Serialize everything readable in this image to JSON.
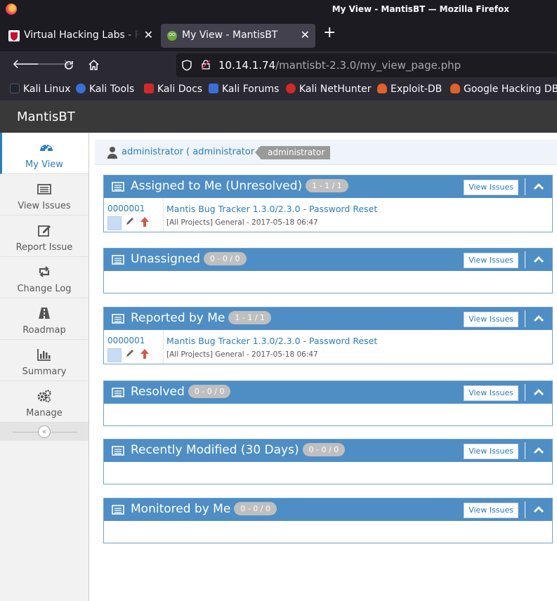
{
  "browser": {
    "window_title": "My View - MantisBT — Mozilla Firefox",
    "tabs": [
      {
        "label": "Virtual Hacking Labs - Re",
        "close": "✕"
      },
      {
        "label": "My View - MantisBT",
        "close": "✕"
      }
    ],
    "new_tab": "+",
    "url_host": "10.14.1.74",
    "url_path": "/mantisbt-2.3.0/my_view_page.php",
    "bookmarks": [
      "Kali Linux",
      "Kali Tools",
      "Kali Docs",
      "Kali Forums",
      "Kali NetHunter",
      "Exploit-DB",
      "Google Hacking DB"
    ]
  },
  "app": {
    "brand": "MantisBT",
    "sidebar": [
      {
        "label": "My View",
        "icon": "dashboard-icon"
      },
      {
        "label": "View Issues",
        "icon": "list-icon"
      },
      {
        "label": "Report Issue",
        "icon": "edit-icon"
      },
      {
        "label": "Change Log",
        "icon": "retweet-icon"
      },
      {
        "label": "Roadmap",
        "icon": "road-icon"
      },
      {
        "label": "Summary",
        "icon": "bar-chart-icon"
      },
      {
        "label": "Manage",
        "icon": "gears-icon"
      }
    ],
    "collapse_glyph": "«",
    "user": {
      "name": "administrator ( administrator )",
      "role": "administrator"
    },
    "view_issues_label": "View Issues",
    "widgets": [
      {
        "title": "Assigned to Me (Unresolved)",
        "badge": "1 - 1 / 1",
        "rows": [
          {
            "id": "0000001",
            "summary": "Mantis Bug Tracker 1.3.0/2.3.0 - Password Reset",
            "meta": "[All Projects] General - 2017-05-18 06:47"
          }
        ]
      },
      {
        "title": "Unassigned",
        "badge": "0 - 0 / 0",
        "rows": []
      },
      {
        "title": "Reported by Me",
        "badge": "1 - 1 / 1",
        "rows": [
          {
            "id": "0000001",
            "summary": "Mantis Bug Tracker 1.3.0/2.3.0 - Password Reset",
            "meta": "[All Projects] General - 2017-05-18 06:47"
          }
        ]
      },
      {
        "title": "Resolved",
        "badge": "0 - 0 / 0",
        "rows": []
      },
      {
        "title": "Recently Modified (30 Days)",
        "badge": "0 - 0 / 0",
        "rows": []
      },
      {
        "title": "Monitored by Me",
        "badge": "0 - 0 / 0",
        "rows": []
      }
    ],
    "colors": {
      "nav": "#393939",
      "widget_header": "#4f8ec5",
      "link": "#2b7dbc",
      "priority_arrow": "#d15b47"
    }
  }
}
